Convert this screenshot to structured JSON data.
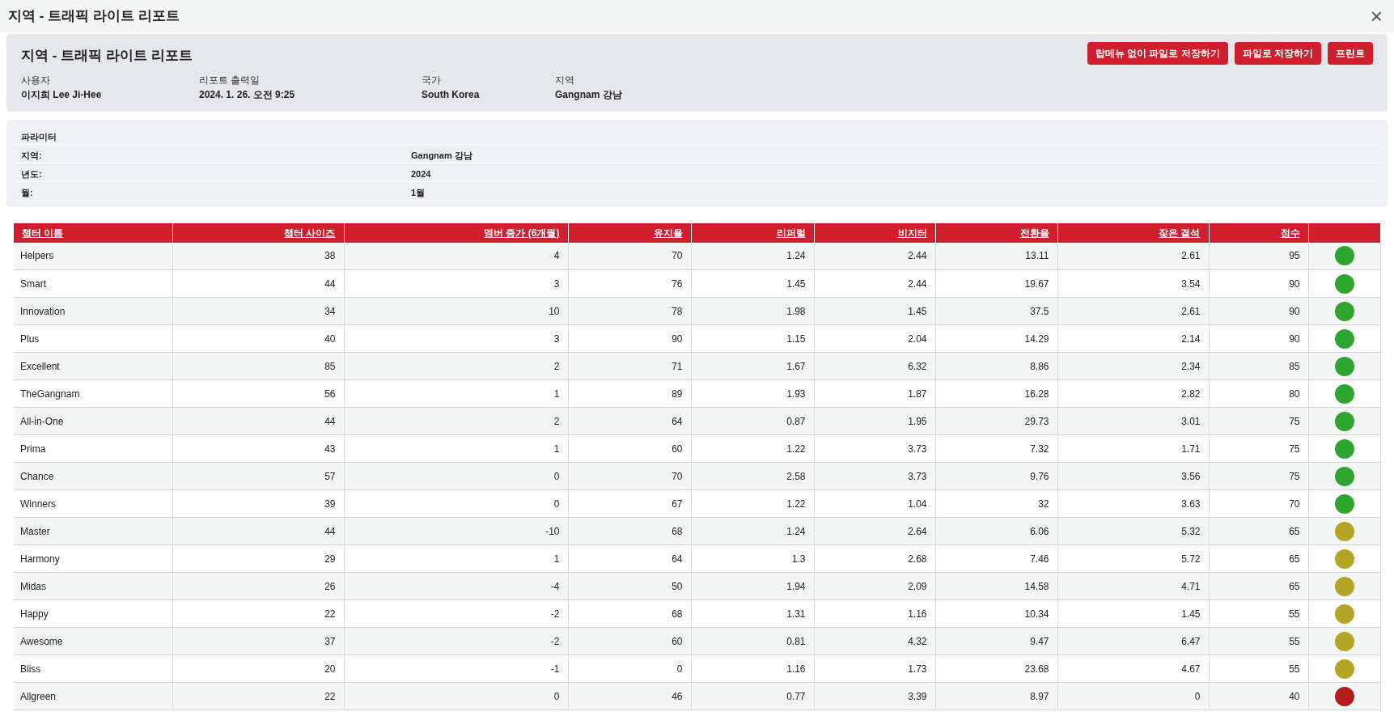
{
  "window": {
    "title": "지역 - 트래픽 라이트 리포트",
    "close": "×"
  },
  "header": {
    "title": "지역 - 트래픽 라이트 리포트",
    "buttons": [
      "탑메뉴 없이 파일로 저장하기",
      "파일로 저장하기",
      "프린트"
    ],
    "fields": [
      {
        "label": "사용자",
        "value": "이지희 Lee Ji-Hee"
      },
      {
        "label": "리포트 출력일",
        "value": "2024. 1. 26. 오전 9:25"
      },
      {
        "label": "국가",
        "value": "South Korea"
      },
      {
        "label": "지역",
        "value": "Gangnam 강남"
      }
    ]
  },
  "parameters": {
    "title": "파라미터",
    "rows": [
      {
        "label": "지역:",
        "value": "Gangnam 강남"
      },
      {
        "label": "년도:",
        "value": "2024"
      },
      {
        "label": "월:",
        "value": "1월"
      }
    ]
  },
  "table": {
    "columns": [
      "챕터 이름",
      "챕터 사이즈",
      "멤버 증가 (6개월)",
      "유지율",
      "리퍼럴",
      "비지터",
      "전환율",
      "잦은 결석",
      "점수"
    ],
    "rows": [
      {
        "cells": [
          "Helpers",
          "38",
          "4",
          "70",
          "1.24",
          "2.44",
          "13.11",
          "2.61",
          "95"
        ],
        "color": "#2ea52e"
      },
      {
        "cells": [
          "Smart",
          "44",
          "3",
          "76",
          "1.45",
          "2.44",
          "19.67",
          "3.54",
          "90"
        ],
        "color": "#2ea52e"
      },
      {
        "cells": [
          "Innovation",
          "34",
          "10",
          "78",
          "1.98",
          "1.45",
          "37.5",
          "2.61",
          "90"
        ],
        "color": "#2ea52e"
      },
      {
        "cells": [
          "Plus",
          "40",
          "3",
          "90",
          "1.15",
          "2.04",
          "14.29",
          "2.14",
          "90"
        ],
        "color": "#2ea52e"
      },
      {
        "cells": [
          "Excellent",
          "85",
          "2",
          "71",
          "1.67",
          "6.32",
          "8.86",
          "2.34",
          "85"
        ],
        "color": "#2ea52e"
      },
      {
        "cells": [
          "TheGangnam",
          "56",
          "1",
          "89",
          "1.93",
          "1.87",
          "16.28",
          "2.82",
          "80"
        ],
        "color": "#2ea52e"
      },
      {
        "cells": [
          "All-in-One",
          "44",
          "2",
          "64",
          "0.87",
          "1.95",
          "29.73",
          "3.01",
          "75"
        ],
        "color": "#2ea52e"
      },
      {
        "cells": [
          "Prima",
          "43",
          "1",
          "60",
          "1.22",
          "3.73",
          "7.32",
          "1.71",
          "75"
        ],
        "color": "#2ea52e"
      },
      {
        "cells": [
          "Chance",
          "57",
          "0",
          "70",
          "2.58",
          "3.73",
          "9.76",
          "3.56",
          "75"
        ],
        "color": "#2ea52e"
      },
      {
        "cells": [
          "Winners",
          "39",
          "0",
          "67",
          "1.22",
          "1.04",
          "32",
          "3.63",
          "70"
        ],
        "color": "#2ea52e"
      },
      {
        "cells": [
          "Master",
          "44",
          "-10",
          "68",
          "1.24",
          "2.64",
          "6.06",
          "5.32",
          "65"
        ],
        "color": "#b5a527"
      },
      {
        "cells": [
          "Harmony",
          "29",
          "1",
          "64",
          "1.3",
          "2.68",
          "7.46",
          "5.72",
          "65"
        ],
        "color": "#b5a527"
      },
      {
        "cells": [
          "Midas",
          "26",
          "-4",
          "50",
          "1.94",
          "2.09",
          "14.58",
          "4.71",
          "65"
        ],
        "color": "#b5a527"
      },
      {
        "cells": [
          "Happy",
          "22",
          "-2",
          "68",
          "1.31",
          "1.16",
          "10.34",
          "1.45",
          "55"
        ],
        "color": "#b5a527"
      },
      {
        "cells": [
          "Awesome",
          "37",
          "-2",
          "60",
          "0.81",
          "4.32",
          "9.47",
          "6.47",
          "55"
        ],
        "color": "#b5a527"
      },
      {
        "cells": [
          "Bliss",
          "20",
          "-1",
          "0",
          "1.16",
          "1.73",
          "23.68",
          "4.67",
          "55"
        ],
        "color": "#b5a527"
      },
      {
        "cells": [
          "Allgreen",
          "22",
          "0",
          "46",
          "0.77",
          "3.39",
          "8.97",
          "0",
          "40"
        ],
        "color": "#b51d1d"
      }
    ]
  }
}
